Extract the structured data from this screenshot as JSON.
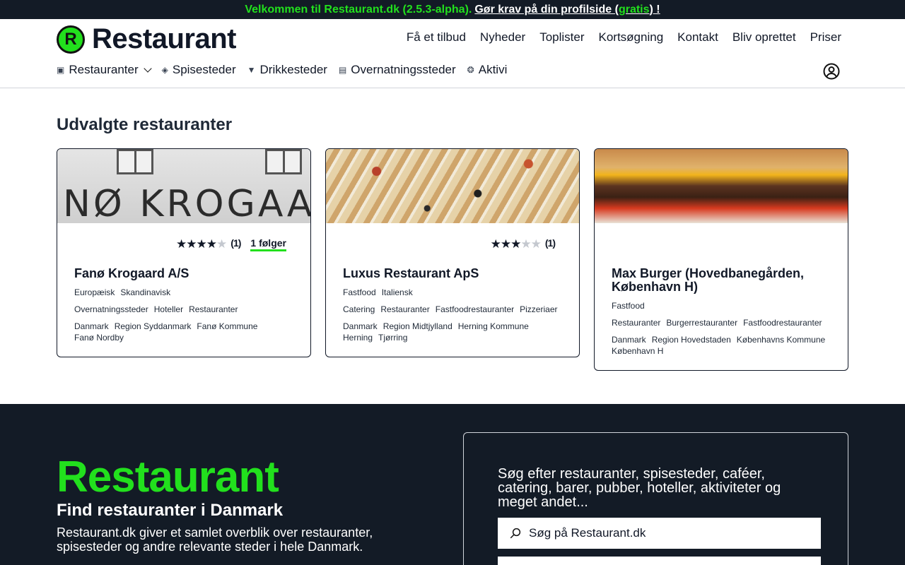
{
  "banner": {
    "welcome": "Velkommen til Restaurant.dk (2.5.3-alpha).",
    "claim_prefix": "Gør krav på din profilside (",
    "claim_gratis": "gratis",
    "claim_suffix": ") !"
  },
  "header": {
    "logo_letter": "R",
    "logo_text": "Restaurant",
    "topnav": [
      "Få et tilbud",
      "Nyheder",
      "Toplister",
      "Kortsøgning",
      "Kontakt",
      "Bliv oprettet",
      "Priser"
    ],
    "categories": [
      {
        "label": "Restauranter",
        "icon": "restaurant-icon",
        "dropdown": true
      },
      {
        "label": "Spisesteder",
        "icon": "dish-icon"
      },
      {
        "label": "Drikkesteder",
        "icon": "cocktail-icon"
      },
      {
        "label": "Overnatningssteder",
        "icon": "bed-icon"
      },
      {
        "label": "Aktivi",
        "icon": "activity-icon"
      }
    ]
  },
  "featured": {
    "title": "Udvalgte restauranter",
    "cards": [
      {
        "name": "Fanø Krogaard A/S",
        "image_sign": "NØ KROGAAR",
        "rating": 4,
        "rating_count": "(1)",
        "followers": "1 følger",
        "cuisines": [
          "Europæisk",
          "Skandinavisk"
        ],
        "types": [
          "Overnatningssteder",
          "Hoteller",
          "Restauranter"
        ],
        "locations": [
          "Danmark",
          "Region Syddanmark",
          "Fanø Kommune",
          "Fanø Nordby"
        ]
      },
      {
        "name": "Luxus Restaurant ApS",
        "rating": 3,
        "rating_count": "(1)",
        "cuisines": [
          "Fastfood",
          "Italiensk"
        ],
        "types": [
          "Catering",
          "Restauranter",
          "Fastfoodrestauranter",
          "Pizzeriaer"
        ],
        "locations": [
          "Danmark",
          "Region Midtjylland",
          "Herning Kommune",
          "Herning",
          "Tjørring"
        ]
      },
      {
        "name": "Max Burger (Hovedbanegården, København H)",
        "cuisines": [
          "Fastfood"
        ],
        "types": [
          "Restauranter",
          "Burgerrestauranter",
          "Fastfoodrestauranter"
        ],
        "locations": [
          "Danmark",
          "Region Hovedstaden",
          "Københavns Kommune",
          "København H"
        ]
      }
    ]
  },
  "hero": {
    "brand": "Restaurant",
    "subtitle": "Find restauranter i Danmark",
    "description": "Restaurant.dk giver et samlet overblik over restauranter, spisesteder og andre relevante steder i hele Danmark."
  },
  "search": {
    "heading": "Søg efter restauranter, spisesteder, caféer, catering, barer, pubber, hoteller, aktiviteter og meget andet...",
    "placeholder": "Søg på Restaurant.dk"
  },
  "colors": {
    "accent": "#22e01d",
    "dark": "#131b26"
  }
}
